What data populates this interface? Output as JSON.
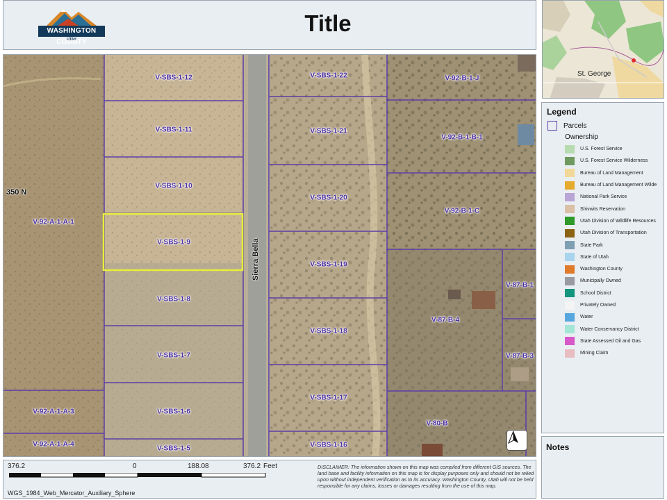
{
  "header": {
    "title": "Title",
    "logo": {
      "name": "WASHINGTON COUNTY",
      "sub": "UTAH"
    }
  },
  "map": {
    "parcels": [
      {
        "id": "V-SBS-1-12"
      },
      {
        "id": "V-SBS-1-11"
      },
      {
        "id": "V-SBS-1-10"
      },
      {
        "id": "V-SBS-1-9"
      },
      {
        "id": "V-SBS-1-8"
      },
      {
        "id": "V-SBS-1-7"
      },
      {
        "id": "V-SBS-1-6"
      },
      {
        "id": "V-SBS-1-5"
      },
      {
        "id": "V-SBS-1-22"
      },
      {
        "id": "V-SBS-1-21"
      },
      {
        "id": "V-SBS-1-20"
      },
      {
        "id": "V-SBS-1-19"
      },
      {
        "id": "V-SBS-1-18"
      },
      {
        "id": "V-SBS-1-17"
      },
      {
        "id": "V-SBS-1-16"
      },
      {
        "id": "V-92-A-1-A-1"
      },
      {
        "id": "V-92-A-1-A-3"
      },
      {
        "id": "V-92-A-1-A-4"
      },
      {
        "id": "V-92-B-1-J"
      },
      {
        "id": "V-92-B-1-B-1"
      },
      {
        "id": "V-92-B-1-C"
      },
      {
        "id": "V-87-B-1"
      },
      {
        "id": "V-87-B-4"
      },
      {
        "id": "V-87-B-3"
      },
      {
        "id": "V-80-B"
      }
    ],
    "selected_parcel": "V-SBS-1-9",
    "roads": {
      "sierra_bella": "Sierra Bella",
      "n350": "350 N"
    },
    "north_arrow": "north-arrow-icon",
    "colors": {
      "parcel_line": "#5b3ea8",
      "selection": "#e6ef3a"
    }
  },
  "overview": {
    "place": "St. George"
  },
  "legend": {
    "title": "Legend",
    "parcels_label": "Parcels",
    "ownership_label": "Ownership",
    "items": [
      {
        "label": "U.S. Forest Service",
        "color": "#b7dbb0"
      },
      {
        "label": "U.S. Forest Service Wilderness",
        "color": "#6f9a5f"
      },
      {
        "label": "Bureau of Land Management",
        "color": "#f2d898"
      },
      {
        "label": "Bureau of Land Management Wilde",
        "color": "#e4ab2f"
      },
      {
        "label": "National Park Service",
        "color": "#b9a6d6"
      },
      {
        "label": "Shivwits Reservation",
        "color": "#d9c0a6"
      },
      {
        "label": "Utah Division of Wildlife Resources",
        "color": "#2e9a2a"
      },
      {
        "label": "Utah Division of Transportation",
        "color": "#8b6314"
      },
      {
        "label": "State Park",
        "color": "#7fa0b3"
      },
      {
        "label": "State of Utah",
        "color": "#a8d4ee"
      },
      {
        "label": "Washington County",
        "color": "#e07a2b"
      },
      {
        "label": "Municipally Owned",
        "color": "#9a9aa3"
      },
      {
        "label": "School District",
        "color": "#13957f"
      },
      {
        "label": "Privately Owned",
        "color": "#f4f4f4"
      },
      {
        "label": "Water",
        "color": "#56a6e0"
      },
      {
        "label": "Water Conservancy District",
        "color": "#a3e6d6"
      },
      {
        "label": "State Assessed Oil and Gas",
        "color": "#d758c9"
      },
      {
        "label": "Mining Claim",
        "color": "#e8bdc2"
      }
    ]
  },
  "notes": {
    "title": "Notes"
  },
  "footer": {
    "scale": {
      "left": "376.2",
      "zero": "0",
      "mid": "188.08",
      "right": "376.2",
      "unit": "Feet"
    },
    "projection": "WGS_1984_Web_Mercator_Auxiliary_Sphere",
    "disclaimer": "DISCLAIMER: The information shown on this map was compiled from different GIS sources. The land base and facility information on this map is for display purposes only and should not be relied upon without independent verification as to its accuracy. Washington County, Utah will not be held responsible for any claims, losses or damages resulting from the use of this map."
  }
}
